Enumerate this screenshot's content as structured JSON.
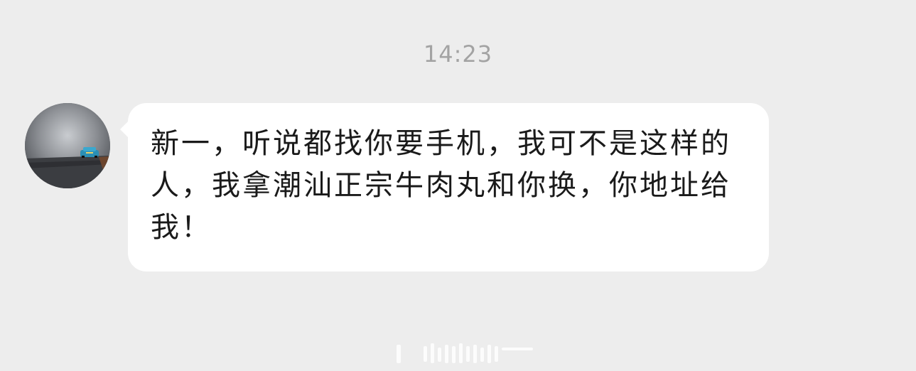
{
  "chat": {
    "timestamp": "14:23",
    "message": {
      "sender_avatar": "car-photo-avatar",
      "text": "新一，听说都找你要手机，我可不是这样的人，我拿潮汕正宗牛肉丸和你换，你地址给我！"
    }
  },
  "colors": {
    "background": "#ededed",
    "bubble": "#ffffff",
    "timestamp": "#a3a3a3",
    "text": "#1a1a1a"
  }
}
